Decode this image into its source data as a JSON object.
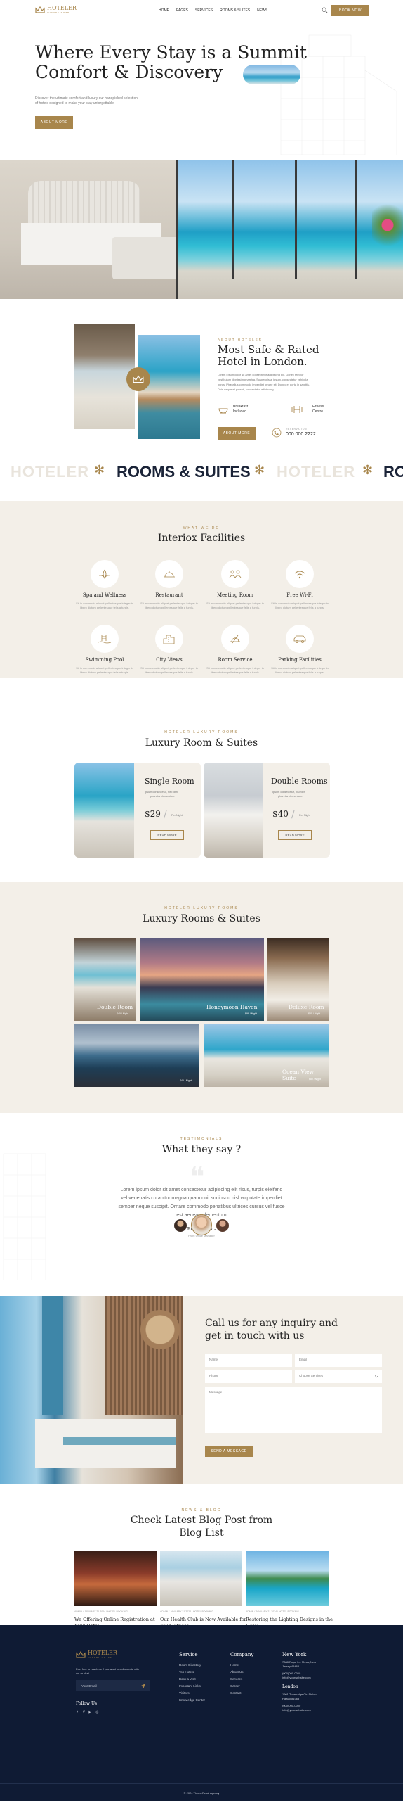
{
  "brand": {
    "name": "HOTELER",
    "tagline": "LUXURY HOTEL"
  },
  "nav": {
    "items": [
      "HOME",
      "PAGES",
      "SERVICES",
      "ROOMS & SUITES",
      "NEWS"
    ],
    "book": "BOOK NOW"
  },
  "hero": {
    "title_l1": "Where Every Stay is a Summit",
    "title_l2": "Comfort & Discovery",
    "sub_l1": "Discover the ultimate comfort and luxury our handpicked selection",
    "sub_l2": "of hotels designed to make your stay unforgettable.",
    "cta": "ABOUT MORE"
  },
  "about": {
    "eyebrow": "ABOUT HOTELER",
    "title_l1": "Most Safe & Rated",
    "title_l2": "Hotel in London.",
    "body": [
      "Lorem ipsum dolor sit amet consectetur adipiscing elit. Donec tempor",
      "vestibulum dignissim pharetra. Suspendisse ipsum, consectetur vehicula",
      "purus. Phasellus commodo imperdiet ornare sit. Donec et porta in sagittis.",
      "Duis neque et potenti, consectetur adipiscing."
    ],
    "f1": "Breakfast Included",
    "f2": "Fitness Centre",
    "cta": "ABOUT MORE",
    "call_label": "RESERVATION",
    "call_number": "000 000 2222"
  },
  "marquee": {
    "items": [
      "HOTELER",
      "ROOMS & SUITES",
      "HOTELER",
      "RO"
    ]
  },
  "facilities": {
    "eyebrow": "WHAT WE DO",
    "title": "Interiox Facilities",
    "items": [
      {
        "name": "Spa and Wellness",
        "d1": "Sit in commodo aliquet pellentesque integer in",
        "d2": "libero dictum pellentesque felis a turpis."
      },
      {
        "name": "Restaurant",
        "d1": "Sit in commodo aliquet pellentesque integer in",
        "d2": "libero dictum pellentesque felis a turpis."
      },
      {
        "name": "Meeting Room",
        "d1": "Sit in commodo aliquet pellentesque integer in",
        "d2": "libero dictum pellentesque felis a turpis."
      },
      {
        "name": "Free Wi-Fi",
        "d1": "Sit in commodo aliquet pellentesque integer in",
        "d2": "libero dictum pellentesque felis a turpis."
      },
      {
        "name": "Swimming Pool",
        "d1": "Sit in commodo aliquet pellentesque integer in",
        "d2": "libero dictum pellentesque felis a turpis."
      },
      {
        "name": "City Views",
        "d1": "Sit in commodo aliquet pellentesque integer in",
        "d2": "libero dictum pellentesque felis a turpis."
      },
      {
        "name": "Room Service",
        "d1": "Sit in commodo aliquet pellentesque integer in",
        "d2": "libero dictum pellentesque felis a turpis."
      },
      {
        "name": "Parking Facilities",
        "d1": "Sit in commodo aliquet pellentesque integer in",
        "d2": "libero dictum pellentesque felis a turpis."
      }
    ]
  },
  "rooms": {
    "eyebrow": "HOTELER LUXURY ROOMS",
    "title": "Luxury Room & Suites",
    "r1": {
      "name": "Single Room",
      "d1": "Ipsum consectetur, nisi nibh",
      "d2": "pharetra elementum.",
      "price": "$29",
      "per": "Per Night",
      "btn": "READ MORE"
    },
    "r2": {
      "name": "Double Rooms",
      "d1": "Ipsum consectetur, nisi nibh",
      "d2": "pharetra elementum.",
      "price": "$40",
      "per": "Per Night",
      "btn": "READ MORE"
    }
  },
  "gallery": {
    "eyebrow": "HOTELER LUXURY ROOMS",
    "title": "Luxury Rooms & Suites",
    "items": [
      {
        "name": "Double Room",
        "sub": "$40 / Night"
      },
      {
        "name": "Honeymoon Haven",
        "sub": "$99 / Night"
      },
      {
        "name": "Deluxe Room",
        "sub": "$60 / Night"
      },
      {
        "name": "",
        "sub": "$45 / Night"
      },
      {
        "name": "Ocean View Suite",
        "sub": "$80 / Night"
      }
    ]
  },
  "testimonial": {
    "eyebrow": "TESTIMONIALS",
    "title": "What they say ?",
    "q1": "Lorem ipsum dolor sit amet consectetur adipiscing elit risus, turpis eleifend",
    "q2": "vel venenatis curabitur magna quam dui, sociosqu nisl vulputate imperdiet",
    "q3": "semper neque suscipit. Ornare commodo penatibus ultrices cursus vel fusce",
    "q4": "est aenean elementum",
    "name": "Robert Fox -",
    "role": "Front Office Manager"
  },
  "contact": {
    "title_l1": "Call us for any inquiry and",
    "title_l2": "get in touch with us",
    "name": "Name",
    "email": "Email",
    "phone": "Phone",
    "service": "Choose Services",
    "message": "Message",
    "btn": "SEND A MESSAGE"
  },
  "blog": {
    "eyebrow": "NEWS & BLOG",
    "title_l1": "Check Latest Blog Post from",
    "title_l2": "Blog List",
    "posts": [
      {
        "meta": "ADMIN  /  JANUARY 21 2024  /  HOTEL BOOKING",
        "t1": "We Offering Online Registration at",
        "t2": "Your Hotel"
      },
      {
        "meta": "ADMIN  /  JANUARY 21 2024  /  HOTEL BOOKING",
        "t1": "Our Health Club is Now Available for",
        "t2": "Your Fitness"
      },
      {
        "meta": "ADMIN  /  JANUARY 21 2024  /  HOTEL BOOKING",
        "t1": "Restoring the Lighting Designs in the",
        "t2": "Hotel"
      }
    ]
  },
  "footer": {
    "desc1": "Feel free to reach us if you want to collaborate with",
    "desc2": "us, or chat.",
    "email_ph": "Your Email",
    "follow": "Follow Us",
    "service_h": "Service",
    "service": [
      "Room Directory",
      "Top Hotels",
      "Book a Visit",
      "Important Links",
      "Visitors",
      "Knowledge Center"
    ],
    "company_h": "Company",
    "company": [
      "Home",
      "About Us",
      "Services",
      "Career",
      "Contact"
    ],
    "ny_h": "New York",
    "ny": [
      "7388 Royal Ln. Mesa, New",
      "Jersey 45463",
      "(000)000-0000",
      "info@yourwebsite.com"
    ],
    "ld_h": "London",
    "ld": [
      "1901 Thornridge Cir. Shiloh,",
      "Hawaii 81063",
      "(000)000-0000",
      "info@yourwebsite.com"
    ],
    "copy": "© 2024 ThemeRetail Agency"
  }
}
